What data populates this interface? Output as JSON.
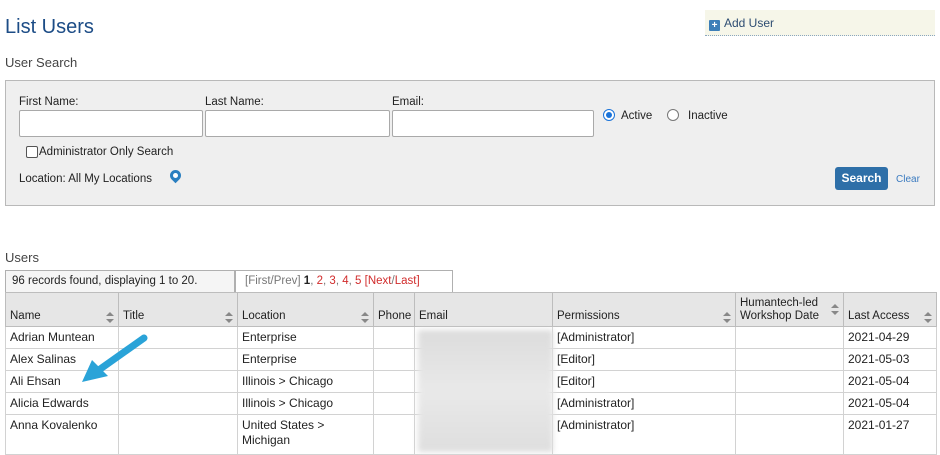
{
  "page": {
    "title": "List Users"
  },
  "actions": {
    "add_user": "Add User"
  },
  "search": {
    "section_title": "User Search",
    "first_name_label": "First Name:",
    "last_name_label": "Last Name:",
    "email_label": "Email:",
    "first_name_value": "",
    "last_name_value": "",
    "email_value": "",
    "status_options": [
      "Active",
      "Inactive"
    ],
    "status_selected": "Active",
    "admin_only_label": "Administrator Only Search",
    "admin_only_checked": false,
    "location_label": "Location: All My Locations",
    "search_button": "Search",
    "clear_link": "Clear"
  },
  "users": {
    "section_title": "Users",
    "records_text": "96 records found, displaying 1 to 20.",
    "pager": {
      "first_prev": "[First/Prev]",
      "current": "1",
      "pages": [
        "2",
        "3",
        "4",
        "5"
      ],
      "next": "[Next",
      "sep": "/",
      "last": "Last]"
    },
    "columns": {
      "name": "Name",
      "title": "Title",
      "location": "Location",
      "phone": "Phone",
      "email": "Email",
      "permissions": "Permissions",
      "workshop_line1": "Humantech-led",
      "workshop_line2": "Workshop Date",
      "last_access": "Last Access"
    },
    "rows": [
      {
        "name": "Adrian Muntean",
        "title": "",
        "location": "Enterprise",
        "phone": "",
        "email": "",
        "permissions": "[Administrator]",
        "workshop": "",
        "last_access": "2021-04-29"
      },
      {
        "name": "Alex Salinas",
        "title": "",
        "location": "Enterprise",
        "phone": "",
        "email": "",
        "permissions": "[Editor]",
        "workshop": "",
        "last_access": "2021-05-03"
      },
      {
        "name": "Ali Ehsan",
        "title": "",
        "location": "Illinois > Chicago",
        "phone": "",
        "email": "",
        "permissions": "[Editor]",
        "workshop": "",
        "last_access": "2021-05-04"
      },
      {
        "name": "Alicia Edwards",
        "title": "",
        "location": "Illinois > Chicago",
        "phone": "",
        "email": "",
        "permissions": "[Administrator]",
        "workshop": "",
        "last_access": "2021-05-04"
      },
      {
        "name": "Anna Kovalenko",
        "title": "",
        "location": "United States > Michigan",
        "phone": "",
        "email": "",
        "permissions": "[Administrator]",
        "workshop": "",
        "last_access": "2021-01-27"
      }
    ]
  },
  "colors": {
    "title": "#1c4c86",
    "search_button": "#2e6fa8",
    "pager_link": "#d12c2c",
    "arrow": "#2aa3d8"
  },
  "icons": {
    "add_user": "plus-square-icon",
    "location": "map-pin-icon",
    "sort": "sort-arrows-icon",
    "annotation": "arrow-annotation-icon"
  }
}
